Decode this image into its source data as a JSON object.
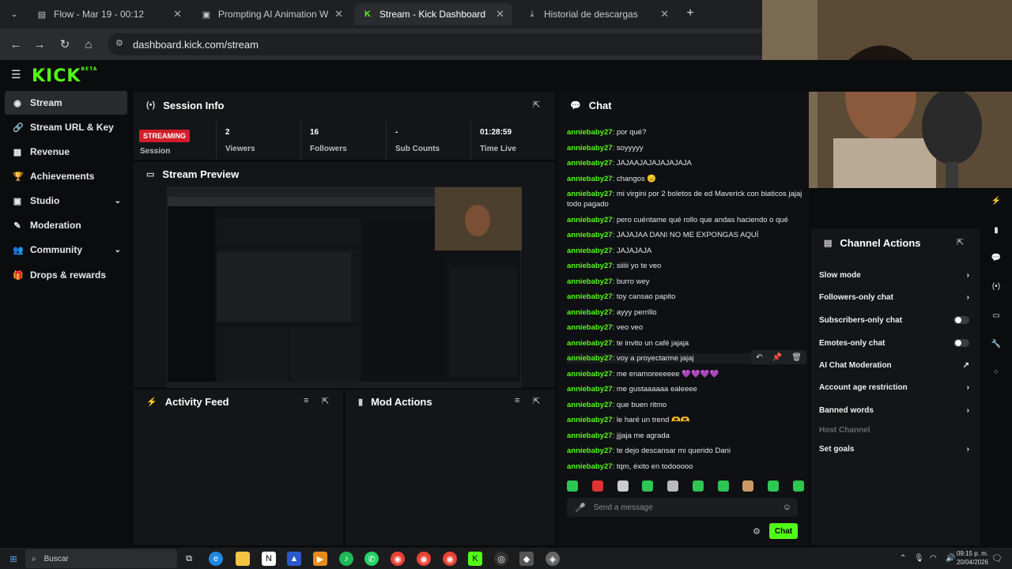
{
  "browser": {
    "tabs": [
      {
        "title": "Flow - Mar 19 - 00:12",
        "icon": "page-icon"
      },
      {
        "title": "Prompting AI Animation Workfl",
        "icon": "window-icon"
      },
      {
        "title": "Stream - Kick Dashboard",
        "icon": "kick-icon"
      },
      {
        "title": "Historial de descargas",
        "icon": "download-icon"
      }
    ],
    "url": "dashboard.kick.com/stream"
  },
  "app": {
    "logo": "KICK",
    "logo_sup": "BETA",
    "accent": "#53fc18"
  },
  "sidebar": {
    "items": [
      {
        "label": "Stream",
        "icon": "radio-icon"
      },
      {
        "label": "Stream URL & Key",
        "icon": "link-icon"
      },
      {
        "label": "Revenue",
        "icon": "chart-icon"
      },
      {
        "label": "Achievements",
        "icon": "trophy-icon"
      },
      {
        "label": "Studio",
        "icon": "film-icon"
      },
      {
        "label": "Moderation",
        "icon": "wrench-icon"
      },
      {
        "label": "Community",
        "icon": "users-icon"
      },
      {
        "label": "Drops & rewards",
        "icon": "gift-icon"
      }
    ]
  },
  "session": {
    "title": "Session Info",
    "badge": "STREAMING",
    "stats": [
      {
        "value": "",
        "label": "Session"
      },
      {
        "value": "2",
        "label": "Viewers"
      },
      {
        "value": "16",
        "label": "Followers"
      },
      {
        "value": "-",
        "label": "Sub Counts"
      },
      {
        "value": "01:28:59",
        "label": "Time Live"
      }
    ]
  },
  "preview": {
    "title": "Stream Preview"
  },
  "activity": {
    "title": "Activity Feed"
  },
  "mod": {
    "title": "Mod Actions"
  },
  "chat": {
    "title": "Chat",
    "user": "anniebaby27",
    "messages": [
      "por qué?",
      "soyyyyy",
      "JAJAAJAJAJAJAJAJA",
      "changos 😑",
      "mi virgini por 2 boletos de ed Maverick con biaticos jajaj todo pagado",
      "pero cuéntame qué rollo que andas haciendo o qué",
      "JAJAJAA DANI NO ME EXPONGAS AQUÍ",
      "JAJAJAJA",
      "siiiii yo te veo",
      "burro wey",
      "toy cansao papito",
      "ayyy perrillo",
      "veo veo",
      "te invito un café jajaja",
      "voy a proyectarme jajaj",
      "me enamoreeeeee 💜💜💜💜",
      "me gustaaaaaa ealeeee",
      "que buen ritmo",
      "le haré un trend 🫶🫶",
      "jjjaja me agrada",
      "te dejo descansar mi querido Dani",
      "tqm, éxito en todooooo"
    ],
    "input_placeholder": "Send a message",
    "send_label": "Chat"
  },
  "channel_actions": {
    "title": "Channel Actions",
    "items": [
      {
        "label": "Slow mode",
        "control": "chevron"
      },
      {
        "label": "Followers-only chat",
        "control": "chevron"
      },
      {
        "label": "Subscribers-only chat",
        "control": "toggle"
      },
      {
        "label": "Emotes-only chat",
        "control": "toggle"
      },
      {
        "label": "AI Chat Moderation",
        "control": "external"
      },
      {
        "label": "Account age restriction",
        "control": "chevron"
      },
      {
        "label": "Banned words",
        "control": "chevron"
      },
      {
        "label": "Host Channel",
        "control": "none"
      },
      {
        "label": "Set goals",
        "control": "chevron"
      }
    ]
  },
  "taskbar": {
    "search_placeholder": "Buscar",
    "time": "09:15 p. m.",
    "date": "20/04/2026"
  }
}
